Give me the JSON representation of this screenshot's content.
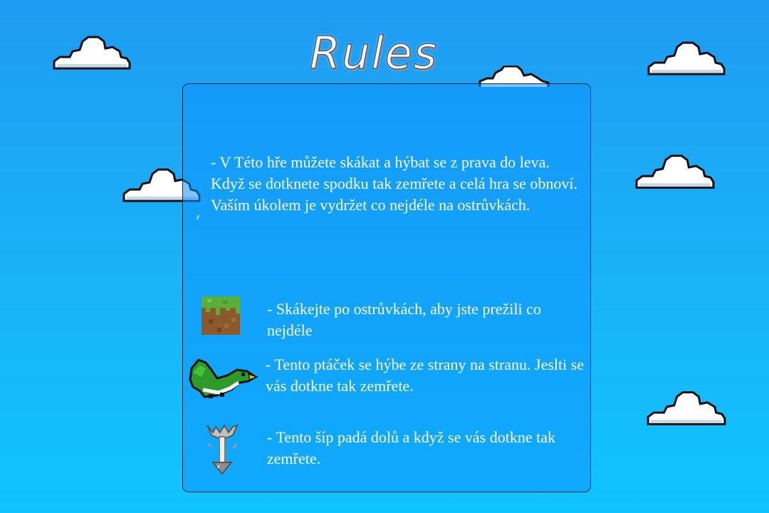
{
  "title": "Rules",
  "rules": {
    "intro": "- V Této hře můžete skákat a hýbat se z prava do leva. Když se dotknete spodku tak zemřete a celá hra se obnoví. Vaším úkolem je vydržet co nejdéle na ostrůvkách.",
    "items": [
      {
        "icon": "grass-block-icon",
        "text": "- Skákejte po ostrůvkách, aby jste prežili co nejdéle"
      },
      {
        "icon": "green-bird-icon",
        "text": "- Tento ptáček se hýbe ze strany na stranu. Jeslti se vás dotkne tak zemřete."
      },
      {
        "icon": "falling-arrow-icon",
        "text": "- Tento šíp padá dolů a když se vás dotkne tak zemřete."
      }
    ]
  },
  "colors": {
    "sky_top": "#1e9bf2",
    "sky_bottom": "#10c4ff",
    "panel": "#0e96ff",
    "text": "#ffffff"
  }
}
